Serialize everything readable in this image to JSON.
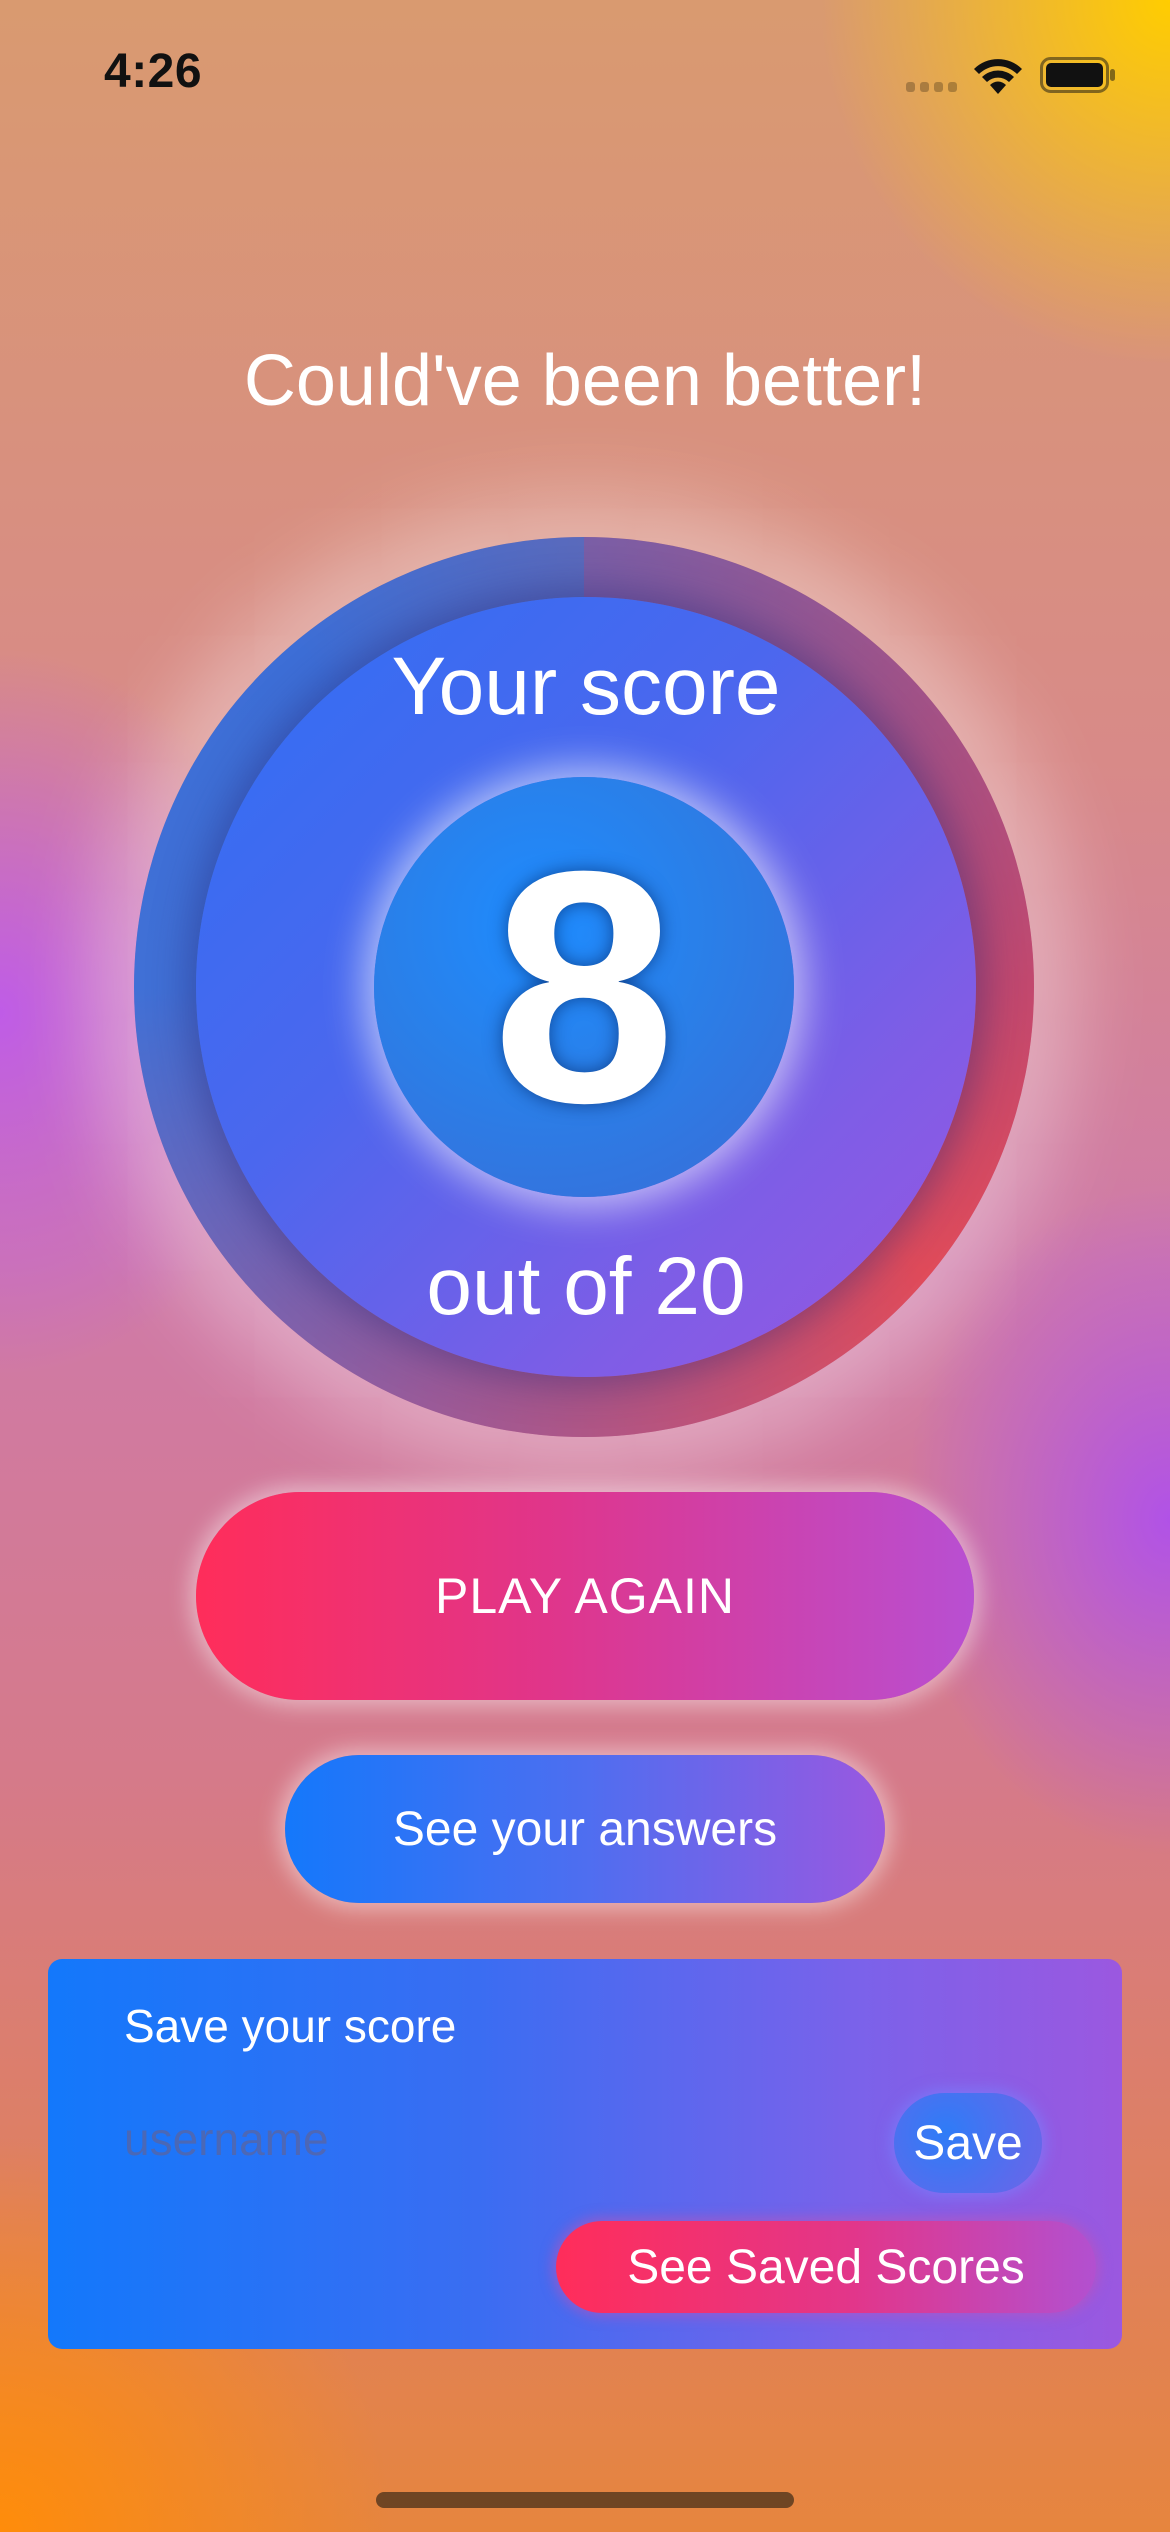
{
  "status_bar": {
    "time": "4:26",
    "icons": [
      "signal-icon",
      "wifi-icon",
      "battery-icon"
    ]
  },
  "result": {
    "feedback": "Could've been better!",
    "score_label": "Your score",
    "score": "8",
    "total_label": "out of 20"
  },
  "actions": {
    "play_again": "PLAY AGAIN",
    "see_answers": "See your answers"
  },
  "save_panel": {
    "title": "Save your score",
    "username_placeholder": "username",
    "username_value": "",
    "save_label": "Save",
    "saved_scores_label": "See Saved Scores"
  },
  "colors": {
    "accent_pink": "#ff2d5a",
    "accent_blue": "#1478fb",
    "accent_purple": "#9b58e0",
    "background_orange": "#e6853e",
    "background_yellow": "#ffcd00"
  }
}
